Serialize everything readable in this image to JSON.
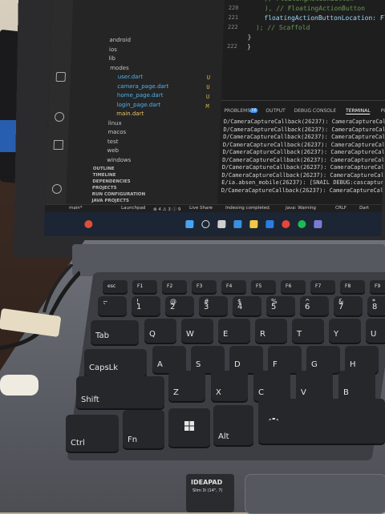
{
  "explorer": {
    "items": [
      {
        "label": "android",
        "cls": ""
      },
      {
        "label": "ios",
        "cls": ""
      },
      {
        "label": "lib",
        "cls": ""
      },
      {
        "label": "modes",
        "cls": ""
      },
      {
        "label": "user.dart",
        "cls": "dart"
      },
      {
        "label": "camera_page.dart",
        "cls": "dart"
      },
      {
        "label": "home_page.dart",
        "cls": "dart"
      },
      {
        "label": "login_page.dart",
        "cls": "dart"
      },
      {
        "label": "main.dart",
        "cls": "sel"
      },
      {
        "label": "linux",
        "cls": ""
      },
      {
        "label": "macos",
        "cls": ""
      },
      {
        "label": "test",
        "cls": ""
      },
      {
        "label": "web",
        "cls": ""
      },
      {
        "label": "windows",
        "cls": ""
      }
    ],
    "sections": [
      "OUTLINE",
      "TIMELINE",
      "DEPENDENCIES",
      "PROJECTS",
      "RUN CONFIGURATION",
      "JAVA PROJECTS"
    ],
    "gutter": [
      "U",
      "U",
      "U",
      "M"
    ]
  },
  "editor": {
    "lines": [
      {
        "num": "219",
        "text": "// FloatingActionButton",
        "kind": "cmt"
      },
      {
        "num": "220",
        "text": "), // FloatingActionButton",
        "kind": "cmt"
      },
      {
        "num": "221",
        "text": "floatingActionButtonLocation: Floa",
        "kind": "prop"
      },
      {
        "num": "222",
        "text": "); // Scaffold",
        "kind": "cmt"
      },
      {
        "num": "",
        "text": "}",
        "kind": ""
      },
      {
        "num": "222",
        "text": "}",
        "kind": ""
      }
    ]
  },
  "panel": {
    "tabs": [
      {
        "label": "PROBLEMS",
        "active": false
      },
      {
        "label": "OUTPUT",
        "active": false
      },
      {
        "label": "DEBUG CONSOLE",
        "active": false
      },
      {
        "label": "TERMINAL",
        "active": true
      },
      {
        "label": "PORTS",
        "active": false
      }
    ],
    "problems_count": "16",
    "terminal": [
      "D/CameraCaptureCallback(26237): CameraCaptureCallbac",
      "D/CameraCaptureCallback(26237): CameraCaptureCallbac",
      "D/CameraCaptureCallback(26237): CameraCaptureCallbac",
      "D/CameraCaptureCallback(26237): CameraCaptureCallbac",
      "D/CameraCaptureCallback(26237): CameraCaptureCallbac",
      "D/CameraCaptureCallback(26237): CameraCaptureCallbac",
      "D/CameraCaptureCallback(26237): CameraCaptureCallbac",
      "D/CameraCaptureCallback(26237): CameraCaptureCallbac",
      "E/ia.absen_mobile(26237): [SNAIL DEBUG:cascapture",
      "D/CameraCaptureCallback(26237): CameraCaptureCallbac"
    ]
  },
  "statusbar": {
    "branch": "main*",
    "launchpad": "Launchpad",
    "counts": "⊗ 4 ⚠ 3 ⓘ 9",
    "live_share": "Live Share",
    "indexing": "Indexing completed.",
    "java": "Java: Warning",
    "eol": "CRLF",
    "lang": "Dart"
  },
  "keyboard": {
    "fn_row": [
      "esc",
      "F1",
      "F2",
      "F3",
      "F4",
      "F5",
      "F6",
      "F7",
      "F8",
      "F9"
    ],
    "num_row": [
      {
        "top": "~",
        "lbl": "`"
      },
      {
        "top": "!",
        "lbl": "1"
      },
      {
        "top": "@",
        "lbl": "2"
      },
      {
        "top": "#",
        "lbl": "3"
      },
      {
        "top": "$",
        "lbl": "4"
      },
      {
        "top": "%",
        "lbl": "5"
      },
      {
        "top": "^",
        "lbl": "6"
      },
      {
        "top": "&",
        "lbl": "7"
      },
      {
        "top": "*",
        "lbl": "8"
      }
    ],
    "tab": "Tab",
    "row_q": [
      "Q",
      "W",
      "E",
      "R",
      "T",
      "Y",
      "U"
    ],
    "caps": "CapsLk",
    "row_a": [
      "A",
      "S",
      "D",
      "F",
      "G",
      "H"
    ],
    "shift": "Shift",
    "row_z": [
      "Z",
      "X",
      "C",
      "V",
      "B"
    ],
    "ctrl": "Ctrl",
    "fn": "Fn",
    "alt": "Alt"
  },
  "badge": {
    "brand": "IDEAPAD",
    "model": "Slim 3i (14\", 7)"
  }
}
